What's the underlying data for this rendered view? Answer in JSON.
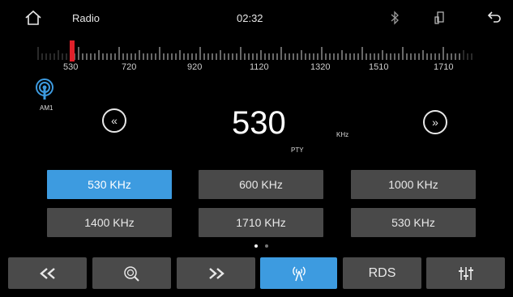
{
  "header": {
    "title": "Radio",
    "time": "02:32"
  },
  "dial": {
    "labels": [
      "530",
      "720",
      "920",
      "1120",
      "1320",
      "1510",
      "1710"
    ]
  },
  "band": {
    "label": "AM1"
  },
  "tuner": {
    "frequency": "530",
    "unit": "KHz",
    "pty": "PTY"
  },
  "presets": [
    "530 KHz",
    "600 KHz",
    "1000 KHz",
    "1400 KHz",
    "1710 KHz",
    "530 KHz"
  ],
  "pager": {
    "pages": 2,
    "active": 1
  },
  "toolbar": {
    "rds_label": "RDS"
  },
  "colors": {
    "accent": "#3d9be0",
    "needle": "#e0202a",
    "button": "#494949"
  }
}
